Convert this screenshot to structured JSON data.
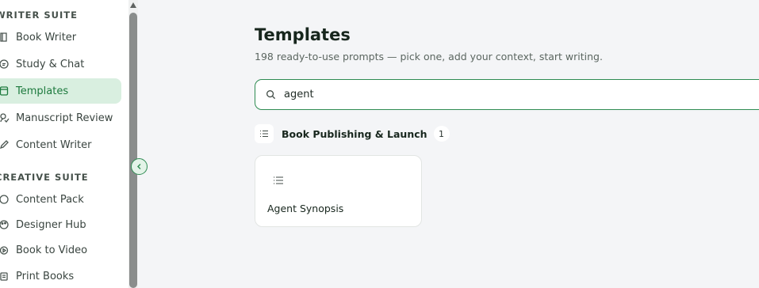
{
  "sidebar": {
    "sections": [
      {
        "title": "WRITER SUITE",
        "items": [
          {
            "label": "Book Writer",
            "icon": "book-icon"
          },
          {
            "label": "Study & Chat",
            "icon": "chat-icon"
          },
          {
            "label": "Templates",
            "icon": "template-icon",
            "active": true
          },
          {
            "label": "Manuscript Review",
            "icon": "review-icon"
          },
          {
            "label": "Content Writer",
            "icon": "pen-icon"
          }
        ]
      },
      {
        "title": "CREATIVE SUITE",
        "items": [
          {
            "label": "Content Pack",
            "icon": "circle-icon"
          },
          {
            "label": "Designer Hub",
            "icon": "palette-icon"
          },
          {
            "label": "Book to Video",
            "icon": "video-icon"
          },
          {
            "label": "Print Books",
            "icon": "print-icon"
          }
        ]
      }
    ]
  },
  "main": {
    "title": "Templates",
    "subtitle": "198 ready-to-use prompts — pick one, add your context, start writing.",
    "search": {
      "value": "agent",
      "placeholder": ""
    },
    "category": {
      "name": "Book Publishing & Launch",
      "count": "1",
      "icon": "list-icon"
    },
    "cards": [
      {
        "title": "Agent Synopsis",
        "icon": "list-icon"
      }
    ]
  },
  "colors": {
    "accent": "#2e8b52",
    "active_bg": "#d9efe0",
    "page_bg": "#f4f5f7"
  }
}
